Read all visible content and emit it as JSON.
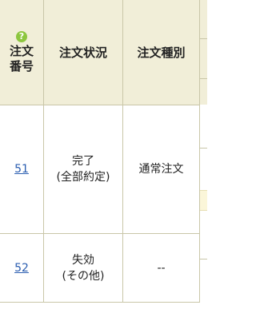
{
  "table": {
    "headers": {
      "number_line1": "注文",
      "number_line2": "番号",
      "status": "注文状況",
      "type": "注文種別",
      "help_icon_glyph": "?"
    },
    "rows": [
      {
        "number": "51",
        "status_line1": "完了",
        "status_line2": "(全部約定)",
        "type": "通常注文"
      },
      {
        "number": "52",
        "status_line1": "失効",
        "status_line2": "(その他)",
        "type": "--"
      }
    ]
  },
  "colors": {
    "header_bg": "#f1eed8",
    "border": "#c9c6a8",
    "link": "#2a5db0",
    "help_icon": "#8dc63f",
    "highlight_strip": "#fbf6d9"
  }
}
